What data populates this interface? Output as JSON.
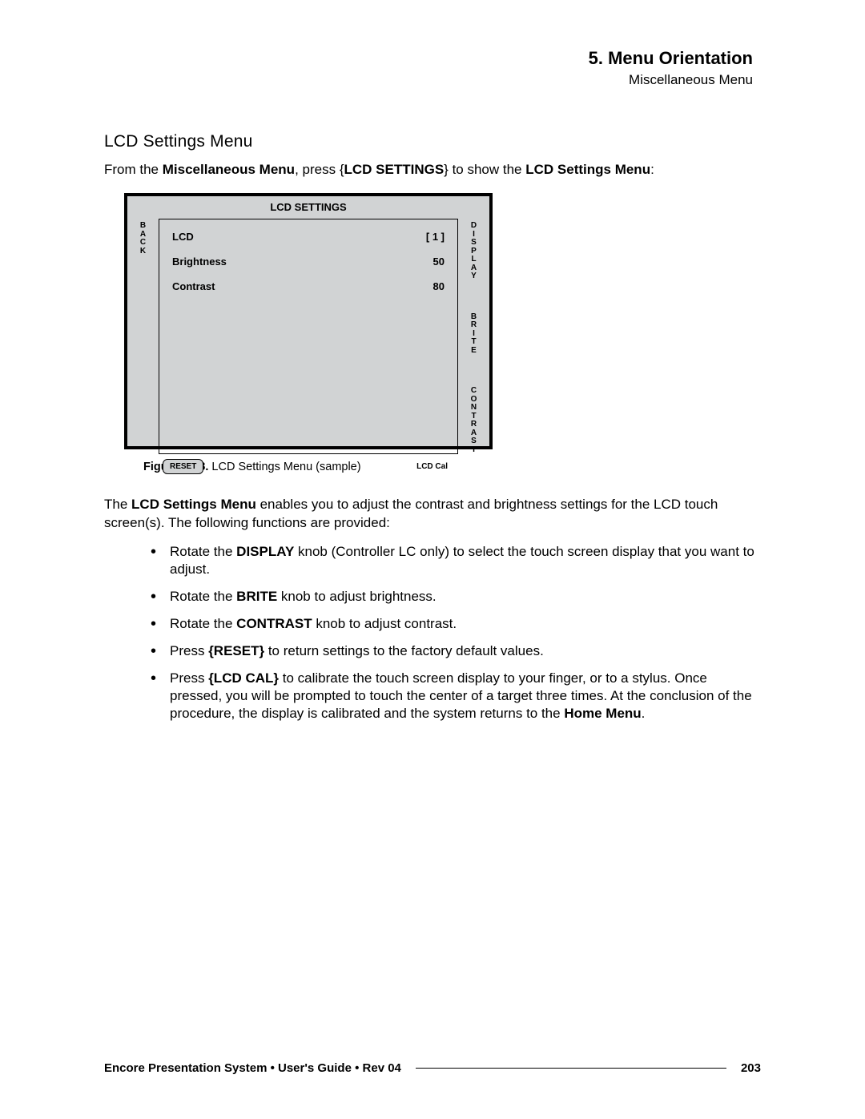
{
  "header": {
    "chapter": "5.  Menu Orientation",
    "breadcrumb": "Miscellaneous Menu"
  },
  "section_title": "LCD Settings Menu",
  "intro": {
    "pre": "From the ",
    "b1": "Miscellaneous Menu",
    "mid1": ", press {",
    "b2": "LCD SETTINGS",
    "mid2": "} to show the ",
    "b3": "LCD Settings Menu",
    "post": ":"
  },
  "lcd": {
    "title": "LCD SETTINGS",
    "back_label": "B\nA\nC\nK",
    "rows": [
      {
        "label": "LCD",
        "value": "[ 1 ]"
      },
      {
        "label": "Brightness",
        "value": "50"
      },
      {
        "label": "Contrast",
        "value": "80"
      }
    ],
    "right_labels": [
      "D\nI\nS\nP\nL\nA\nY",
      "B\nR\nI\nT\nE",
      "C\nO\nN\nT\nR\nA\nS\nT"
    ],
    "reset_label": "RESET",
    "lcdcal_label": "LCD Cal"
  },
  "caption": {
    "label": "Figure 5-48.",
    "text": "  LCD Settings Menu  (sample)"
  },
  "desc": {
    "pre": "The ",
    "b1": "LCD Settings Menu",
    "post": " enables you to adjust the contrast and brightness settings for the LCD touch screen(s).  The following functions are provided:"
  },
  "bullets": [
    {
      "pre": "Rotate the ",
      "b": "DISPLAY",
      "post": " knob (Controller LC only) to select the touch screen display that you want to adjust."
    },
    {
      "pre": "Rotate the ",
      "b": "BRITE",
      "post": " knob to adjust brightness."
    },
    {
      "pre": "Rotate the ",
      "b": "CONTRAST",
      "post": " knob to adjust contrast."
    },
    {
      "pre": "Press ",
      "b": "{RESET}",
      "post": " to return settings to the factory default values."
    }
  ],
  "bullet5": {
    "pre": "Press ",
    "b1": "{LCD CAL}",
    "mid": " to calibrate the touch screen display to your finger, or to a stylus.  Once pressed, you will be prompted to touch the center of a target three times.  At the conclusion of the procedure, the display is calibrated and the system returns to the ",
    "b2": "Home Menu",
    "post": "."
  },
  "footer": {
    "text": "Encore Presentation System  •  User's Guide  •  Rev 04",
    "page": "203"
  }
}
